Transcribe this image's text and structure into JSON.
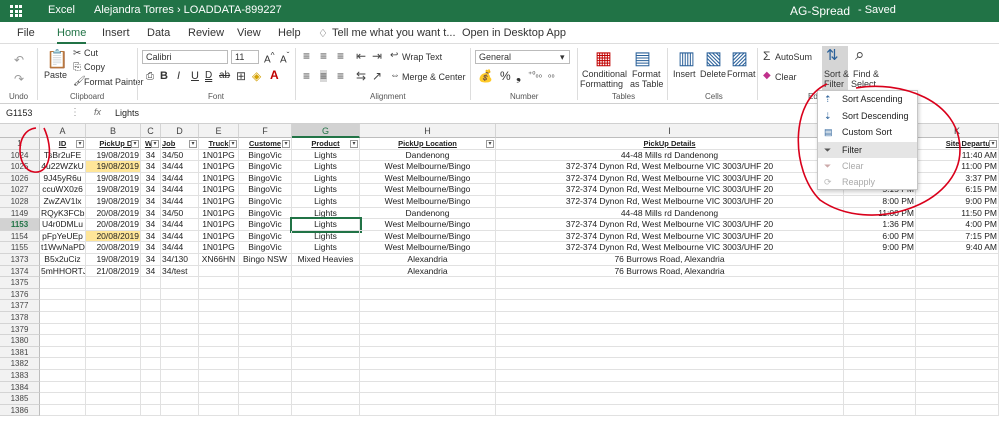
{
  "titlebar": {
    "app": "Excel",
    "breadcrumb": "Alejandra Torres  ›  LOADDATA-899227",
    "doc_title": "AG-Spread",
    "save_status": "-  Saved"
  },
  "menu": [
    "File",
    "Home",
    "Insert",
    "Data",
    "Review",
    "View",
    "Help",
    "Tell me what you want t...",
    "Open in Desktop App"
  ],
  "ribbon": {
    "clipboard": {
      "paste": "Paste",
      "cut": "Cut",
      "copy": "Copy",
      "format_painter": "Format Painter",
      "undo": "Undo",
      "group": "Clipboard"
    },
    "font": {
      "name": "Calibri",
      "size": "11",
      "group": "Font"
    },
    "alignment": {
      "wrap": "Wrap Text",
      "merge": "Merge & Center",
      "group": "Alignment"
    },
    "number": {
      "format": "General",
      "group": "Number"
    },
    "tables": {
      "conditional1": "Conditional",
      "conditional2": "Formatting",
      "format1": "Format",
      "format2": "as Table",
      "group": "Tables"
    },
    "cells": {
      "insert": "Insert",
      "delete": "Delete",
      "format": "Format",
      "group": "Cells"
    },
    "editing": {
      "autosum": "AutoSum",
      "clear": "Clear",
      "sort1": "Sort &",
      "sort2": "Filter",
      "find1": "Find &",
      "find2": "Select",
      "group": "Edit"
    }
  },
  "formula_bar": {
    "name_box": "G1153",
    "fx": "fx",
    "content": "Lights"
  },
  "columns": [
    "A",
    "B",
    "C",
    "D",
    "E",
    "F",
    "G",
    "H",
    "I",
    "K"
  ],
  "header_row": {
    "num": "1",
    "cells": [
      "ID",
      "PickUp Dat",
      "We",
      "Job",
      "Truck",
      "Custome",
      "Product",
      "PickUp Location",
      "PickUp Details",
      "Site Departure"
    ]
  },
  "rows": [
    {
      "num": "1024",
      "cells": [
        "TsBr2uFE",
        "19/08/2019",
        "34",
        "34/50",
        "1N01PG",
        "BingoVic",
        "Lights",
        "Dandenong",
        "44-48 Mills rd Dandenong",
        "11:40 AM"
      ]
    },
    {
      "num": "1025",
      "cells": [
        "4u22WZkU",
        "19/08/2019",
        "34",
        "34/44",
        "1N01PG",
        "BingoVic",
        "Lights",
        "West Melbourne/Bingo",
        "372-374 Dynon Rd, West Melbourne VIC 3003/UHF 20",
        "11:00 PM"
      ]
    },
    {
      "num": "1026",
      "cells": [
        "9J45yR6u",
        "19/08/2019",
        "34",
        "34/44",
        "1N01PG",
        "BingoVic",
        "Lights",
        "West Melbourne/Bingo",
        "372-374 Dynon Rd, West Melbourne VIC 3003/UHF 20",
        "3:37 PM"
      ]
    },
    {
      "num": "1027",
      "cells": [
        "ccuWX0z6",
        "19/08/2019",
        "34",
        "34/44",
        "1N01PG",
        "BingoVic",
        "Lights",
        "West Melbourne/Bingo",
        "372-374 Dynon Rd, West Melbourne VIC 3003/UHF 20",
        "6:15 PM"
      ]
    },
    {
      "num": "1028",
      "cells": [
        "ZwZAV1lx",
        "19/08/2019",
        "34",
        "34/44",
        "1N01PG",
        "BingoVic",
        "Lights",
        "West Melbourne/Bingo",
        "372-374 Dynon Rd, West Melbourne VIC 3003/UHF 20",
        "9:00 PM"
      ]
    },
    {
      "num": "1149",
      "cells": [
        "RQyK3FCb",
        "20/08/2019",
        "34",
        "34/50",
        "1N01PG",
        "BingoVic",
        "Lights",
        "Dandenong",
        "44-48 Mills rd Dandenong",
        "11:50 PM"
      ]
    },
    {
      "num": "1153",
      "cells": [
        "U4r0DMLu",
        "20/08/2019",
        "34",
        "34/44",
        "1N01PG",
        "BingoVic",
        "Lights",
        "West Melbourne/Bingo",
        "372-374 Dynon Rd, West Melbourne VIC 3003/UHF 20",
        "4:00 PM"
      ]
    },
    {
      "num": "1154",
      "cells": [
        "pFpYeUEp",
        "20/08/2019",
        "34",
        "34/44",
        "1N01PG",
        "BingoVic",
        "Lights",
        "West Melbourne/Bingo",
        "372-374 Dynon Rd, West Melbourne VIC 3003/UHF 20",
        "7:15 PM"
      ]
    },
    {
      "num": "1155",
      "cells": [
        "t1WwNaPD",
        "20/08/2019",
        "34",
        "34/44",
        "1N01PG",
        "BingoVic",
        "Lights",
        "West Melbourne/Bingo",
        "372-374 Dynon Rd, West Melbourne VIC 3003/UHF 20",
        "9:40 AM"
      ]
    },
    {
      "num": "1373",
      "cells": [
        "B5x2uCiz",
        "19/08/2019",
        "34",
        "34/130",
        "XN66HN",
        "Bingo NSW",
        "Mixed Heavies",
        "Alexandria",
        "76 Burrows Road, Alexandria",
        ""
      ]
    },
    {
      "num": "1374",
      "cells": [
        "5mHHORTJ",
        "21/08/2019",
        "34",
        "34/test",
        "",
        "",
        "",
        "Alexandria",
        "76 Burrows Road, Alexandria",
        ""
      ]
    }
  ],
  "col_j_values": [
    "",
    "",
    "",
    "5:15 PM",
    "8:00 PM",
    "11:00 PM",
    "1:36 PM",
    "6:00 PM",
    "9:00 PM",
    "",
    ""
  ],
  "empty_rows": [
    "1375",
    "1376",
    "1377",
    "1378",
    "1379",
    "1380",
    "1381",
    "1382",
    "1383",
    "1384",
    "1385",
    "1386"
  ],
  "highlighted_dates": [
    1,
    7
  ],
  "dropdown": {
    "items": [
      "Sort Ascending",
      "Sort Descending",
      "Custom Sort",
      "Filter",
      "Clear",
      "Reapply"
    ]
  },
  "colors": {
    "excel_green": "#217346",
    "highlight": "#ffe699",
    "annotation": "#d9001b"
  }
}
